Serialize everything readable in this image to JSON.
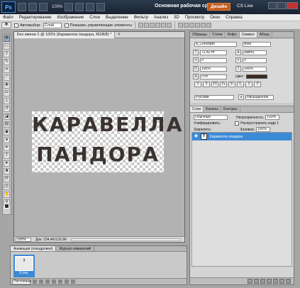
{
  "titlebar": {
    "logo": "Ps",
    "zoom": "100%",
    "workspace": "Основная рабочая среда",
    "design_button": "Дизайн",
    "cs_live": "CS Live"
  },
  "menu": [
    "Файл",
    "Редактирование",
    "Изображение",
    "Слои",
    "Выделение",
    "Фильтр",
    "Анализ",
    "3D",
    "Просмотр",
    "Окно",
    "Справка"
  ],
  "options": {
    "autoselect_label": "Автовыбор:",
    "autoselect_value": "Слой",
    "show_controls_label": "Показать управляющие элементы"
  },
  "document": {
    "tab_title": "Без имени-1 @ 100% (Каравелла пандора, RGB/8) *",
    "canvas_line1": "КАРАВЕЛЛА",
    "canvas_line2": "ПАНДОРА",
    "zoom": "100%",
    "doc_info": "Док: 234,4K/132,6K"
  },
  "animation": {
    "tabs": [
      "Анимация (покадровая)",
      "Журнал измерений"
    ],
    "frame_label": "1",
    "frame_time": "0 сек.",
    "loop": "Постоянно"
  },
  "character_panel": {
    "tabs": [
      "Образцы",
      "Стили",
      "Инфо",
      "Символ",
      "Абзац"
    ],
    "font_family": "a_Concepto",
    "font_style": "Bold",
    "font_size": "72,42 пт",
    "leading": "(Авто)",
    "kerning": "0",
    "tracking": "0",
    "vscale": "100%",
    "hscale": "100%",
    "baseline": "0 пт",
    "color_label": "Цвет:",
    "language": "Русский",
    "antialias": "Насыщенное"
  },
  "layers_panel": {
    "tabs": [
      "Слои",
      "Каналы",
      "Контуры"
    ],
    "blend_mode": "Обычные",
    "opacity_label": "Непрозрачность:",
    "opacity": "100%",
    "unify_label": "Унифицировать:",
    "propagate_label": "Распространить кадр 1",
    "lock_label": "Закрепить:",
    "fill_label": "Заливка:",
    "fill": "100%",
    "layer_name": "Каравелла пандора"
  },
  "colors": {
    "selection": "#3b8ad6",
    "text": "#3a3330"
  }
}
